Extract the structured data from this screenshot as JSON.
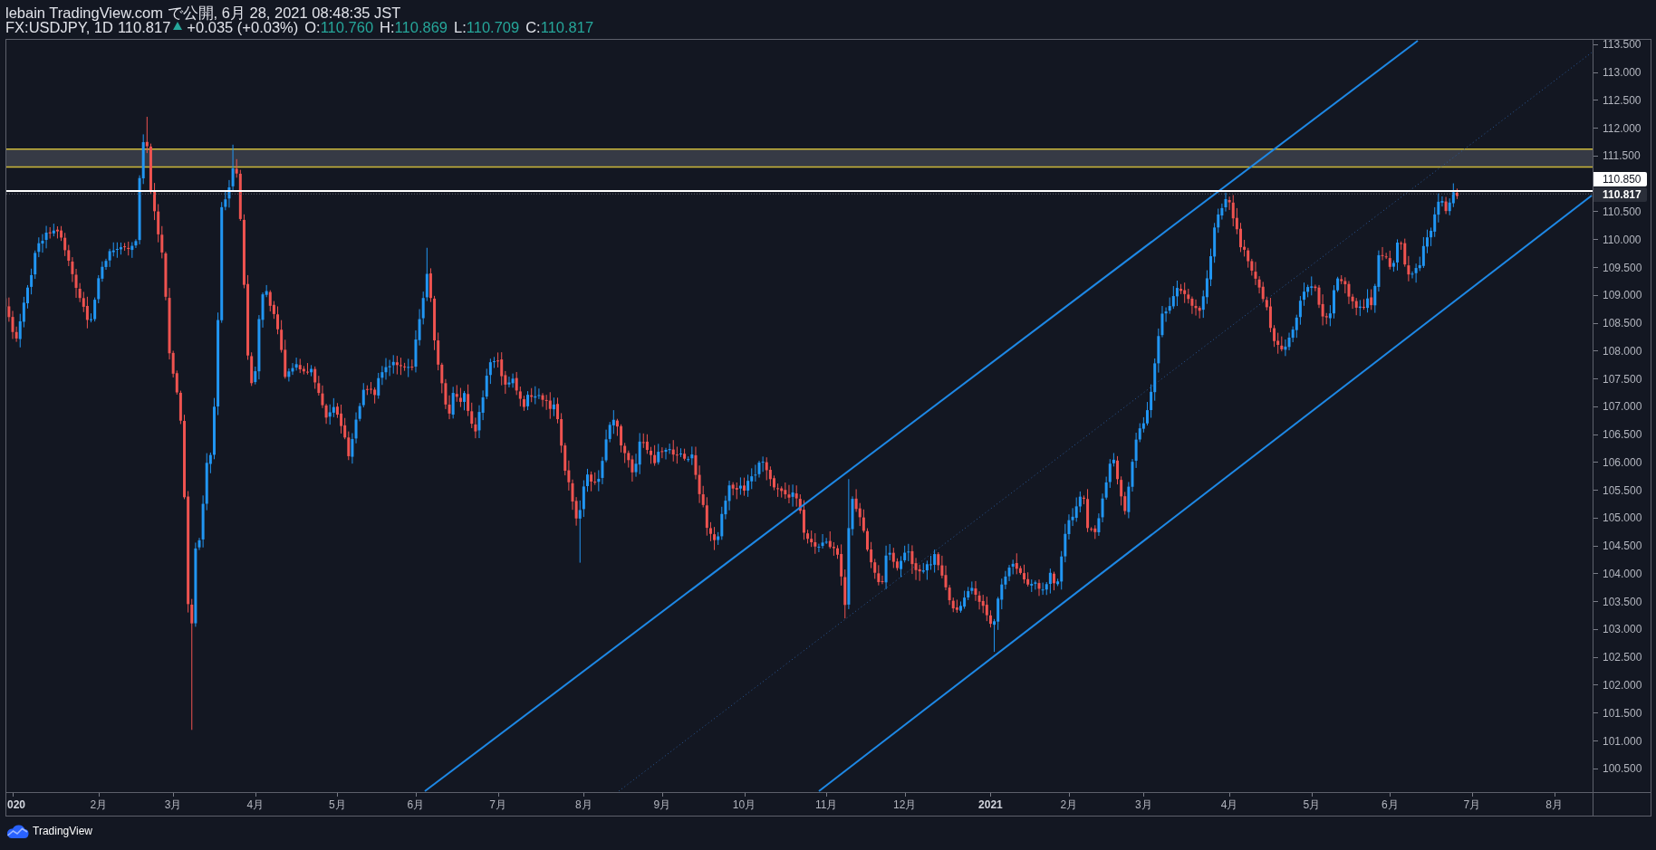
{
  "header": {
    "publisher_line": "lebain TradingView.com で公開, 6月 28, 2021 08:48:35 JST",
    "symbol": "FX:USDJPY, 1D",
    "last_price": "110.817",
    "rising": true,
    "change": "+0.035 (+0.03%)",
    "ohlc": [
      {
        "label": "O:",
        "value": "110.760"
      },
      {
        "label": "H:",
        "value": "110.869"
      },
      {
        "label": "L:",
        "value": "110.709"
      },
      {
        "label": "C:",
        "value": "110.817"
      }
    ]
  },
  "price_axis": {
    "labels": [
      "113.500",
      "113.000",
      "112.500",
      "112.000",
      "111.500",
      "110.500",
      "110.000",
      "109.500",
      "109.000",
      "108.500",
      "108.000",
      "107.500",
      "107.000",
      "106.500",
      "106.000",
      "105.500",
      "105.000",
      "104.500",
      "104.000",
      "103.500",
      "103.000",
      "102.500",
      "102.000",
      "101.500",
      "101.000",
      "100.500"
    ]
  },
  "price_badges": [
    {
      "kind": "line",
      "text": "110.850"
    },
    {
      "kind": "last",
      "text": "110.817"
    }
  ],
  "time_axis": {
    "labels": [
      {
        "kind": "year",
        "text": "020"
      },
      {
        "kind": "month",
        "text": "2月"
      },
      {
        "kind": "month",
        "text": "3月"
      },
      {
        "kind": "month",
        "text": "4月"
      },
      {
        "kind": "month",
        "text": "5月"
      },
      {
        "kind": "month",
        "text": "6月"
      },
      {
        "kind": "month",
        "text": "7月"
      },
      {
        "kind": "month",
        "text": "8月"
      },
      {
        "kind": "month",
        "text": "9月"
      },
      {
        "kind": "month",
        "text": "10月"
      },
      {
        "kind": "month",
        "text": "11月"
      },
      {
        "kind": "month",
        "text": "12月"
      },
      {
        "kind": "year",
        "text": "2021"
      },
      {
        "kind": "month",
        "text": "2月"
      },
      {
        "kind": "month",
        "text": "3月"
      },
      {
        "kind": "month",
        "text": "4月"
      },
      {
        "kind": "month",
        "text": "5月"
      },
      {
        "kind": "month",
        "text": "6月"
      },
      {
        "kind": "month",
        "text": "7月"
      },
      {
        "kind": "month",
        "text": "8月"
      }
    ]
  },
  "footer": {
    "brand": "TradingView"
  }
}
